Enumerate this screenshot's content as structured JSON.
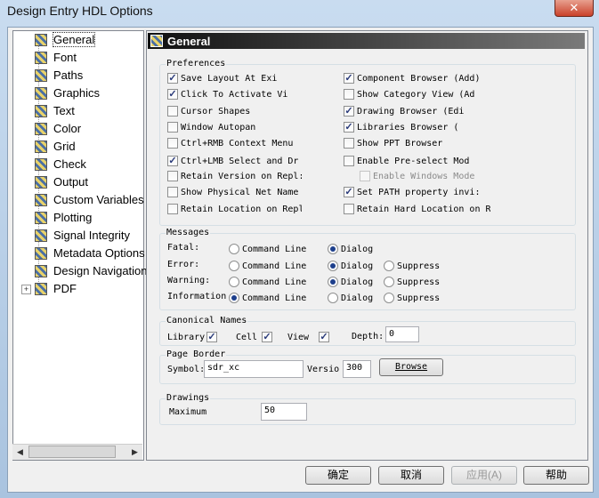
{
  "window": {
    "title": "Design Entry HDL Options",
    "close_label": "✕"
  },
  "tree": {
    "items": [
      {
        "label": "General",
        "selected": true
      },
      {
        "label": "Font"
      },
      {
        "label": "Paths"
      },
      {
        "label": "Graphics"
      },
      {
        "label": "Text"
      },
      {
        "label": "Color"
      },
      {
        "label": "Grid"
      },
      {
        "label": "Check"
      },
      {
        "label": "Output"
      },
      {
        "label": "Custom Variables"
      },
      {
        "label": "Plotting"
      },
      {
        "label": "Signal Integrity"
      },
      {
        "label": "Metadata Options"
      },
      {
        "label": "Design Navigation"
      },
      {
        "label": "PDF",
        "expandable": true
      }
    ],
    "expander_label": "+",
    "scroll_left": "◀",
    "scroll_right": "▶"
  },
  "panel": {
    "title": "General"
  },
  "preferences": {
    "label": "Preferences",
    "left": [
      {
        "label": "Save Layout At Exi",
        "checked": true
      },
      {
        "label": "Click To Activate Vi",
        "checked": true
      },
      {
        "label": "Cursor Shapes",
        "checked": false
      },
      {
        "label": "Window Autopan",
        "checked": false
      },
      {
        "label": "Ctrl+RMB Context Menu",
        "checked": false
      },
      {
        "label": "Ctrl+LMB Select and Dr",
        "checked": true
      },
      {
        "label": "Retain Version on Repl:",
        "checked": false
      },
      {
        "label": "Show Physical Net Name",
        "checked": false
      },
      {
        "label": "Retain Location on Repl",
        "checked": false
      }
    ],
    "right": [
      {
        "label": "Component Browser (Add)",
        "checked": true
      },
      {
        "label": "Show Category View (Ad",
        "checked": false
      },
      {
        "label": "Drawing Browser (Edi",
        "checked": true
      },
      {
        "label": "Libraries Browser (",
        "checked": true
      },
      {
        "label": "Show PPT Browser",
        "checked": false
      },
      {
        "label": "Enable Pre-select Mod",
        "checked": false
      },
      {
        "label": "Enable Windows Mode",
        "checked": false,
        "disabled": true
      },
      {
        "label": "Set PATH property invi:",
        "checked": true
      },
      {
        "label": "Retain Hard Location on Repl",
        "checked": false
      }
    ]
  },
  "messages": {
    "label": "Messages",
    "rows": [
      {
        "label": "Fatal:",
        "options": [
          "Command Line",
          "Dialog"
        ],
        "selected": 1
      },
      {
        "label": "Error:",
        "options": [
          "Command Line",
          "Dialog",
          "Suppress"
        ],
        "selected": 1
      },
      {
        "label": "Warning:",
        "options": [
          "Command Line",
          "Dialog",
          "Suppress"
        ],
        "selected": 1
      },
      {
        "label": "Information",
        "options": [
          "Command Line",
          "Dialog",
          "Suppress"
        ],
        "selected": 0
      }
    ]
  },
  "canonical": {
    "label": "Canonical Names",
    "library_label": "Library",
    "library_checked": true,
    "cell_label": "Cell",
    "cell_checked": true,
    "view_label": "View",
    "view_checked": true,
    "depth_label": "Depth:",
    "depth_value": "0"
  },
  "page_border": {
    "label": "Page Border",
    "symbol_label": "Symbol:",
    "symbol_value": "sdr_xc",
    "version_label": "Versio",
    "version_value": "300",
    "browse_label": "Browse"
  },
  "drawings": {
    "label": "Drawings",
    "maximum_label": "Maximum",
    "maximum_value": "50"
  },
  "buttons": {
    "ok": "确定",
    "cancel": "取消",
    "apply": "应用(A)",
    "help": "帮助"
  },
  "check_mark": "✓"
}
